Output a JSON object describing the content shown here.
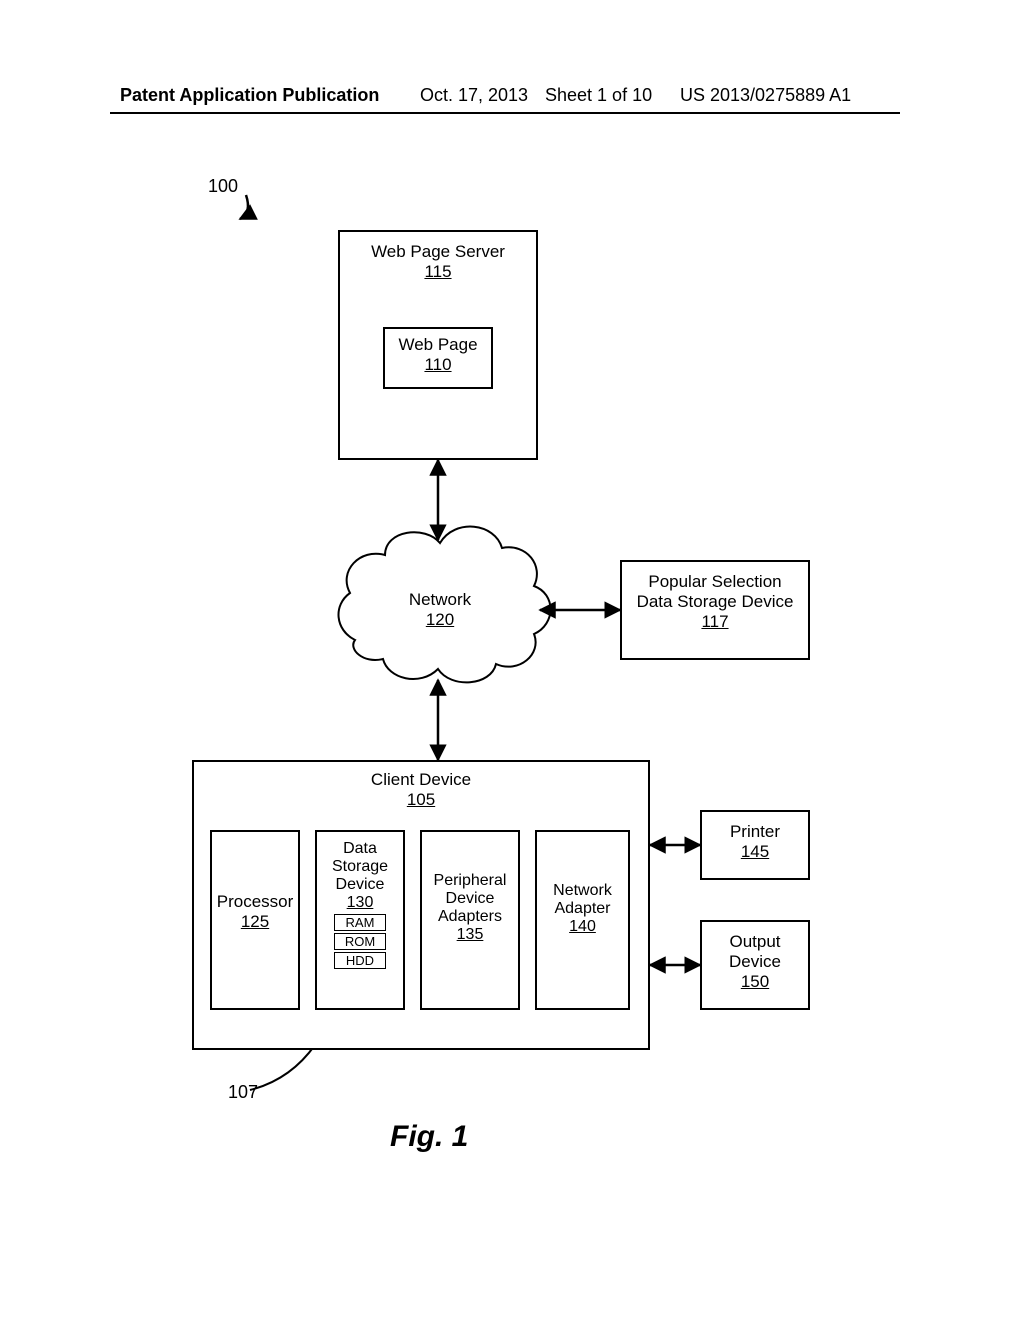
{
  "header": {
    "left": "Patent Application Publication",
    "date": "Oct. 17, 2013",
    "sheet": "Sheet 1 of 10",
    "pubno": "US 2013/0275889 A1"
  },
  "fig_ref_100": "100",
  "fig_ref_107": "107",
  "caption": "Fig. 1",
  "server": {
    "title": "Web Page Server",
    "ref": "115",
    "inner_title": "Web Page",
    "inner_ref": "110"
  },
  "network": {
    "title": "Network",
    "ref": "120"
  },
  "storage_ext": {
    "line1": "Popular Selection",
    "line2": "Data Storage Device",
    "ref": "117"
  },
  "client": {
    "title": "Client Device",
    "ref": "105",
    "processor": {
      "title": "Processor",
      "ref": "125"
    },
    "dsd": {
      "line1": "Data",
      "line2": "Storage",
      "line3": "Device",
      "ref": "130",
      "ram": "RAM",
      "rom": "ROM",
      "hdd": "HDD"
    },
    "pda": {
      "line1": "Peripheral",
      "line2": "Device",
      "line3": "Adapters",
      "ref": "135"
    },
    "na": {
      "line1": "Network",
      "line2": "Adapter",
      "ref": "140"
    }
  },
  "printer": {
    "title": "Printer",
    "ref": "145"
  },
  "output": {
    "line1": "Output",
    "line2": "Device",
    "ref": "150"
  }
}
